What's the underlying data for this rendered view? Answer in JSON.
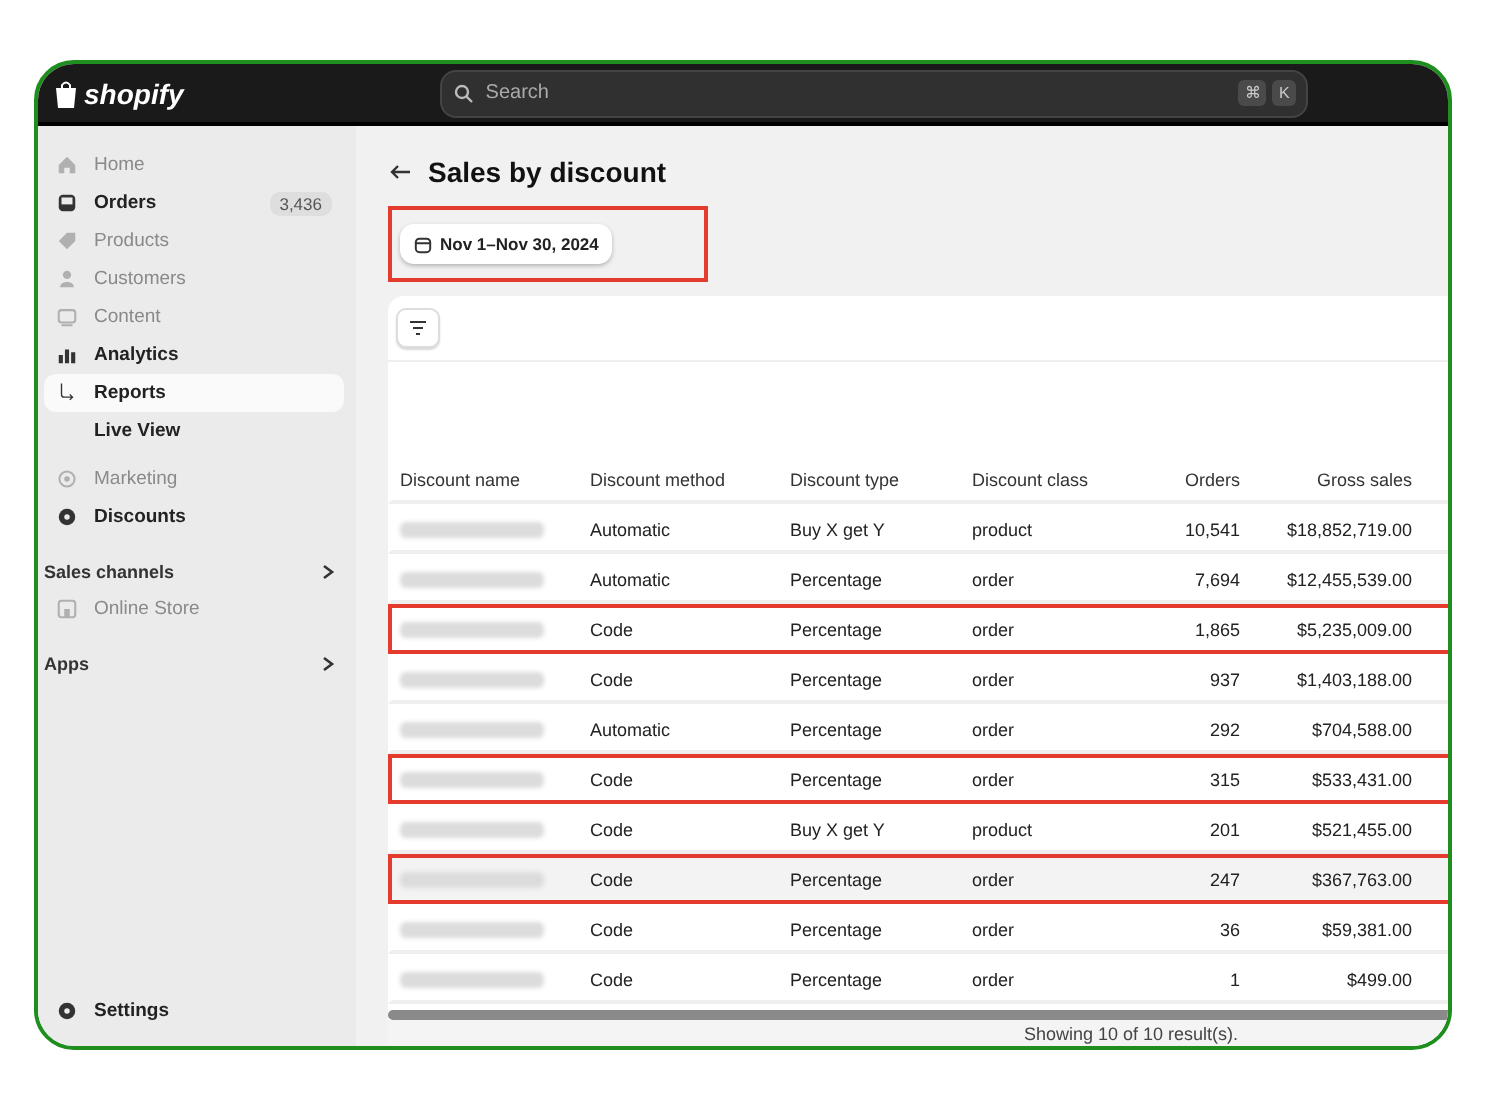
{
  "top_bar": {
    "logo": "shopify",
    "search": {
      "placeholder": "Search"
    },
    "shortcut_keys": [
      "⌘",
      "K"
    ]
  },
  "sidebar": {
    "items": [
      {
        "label": "Home",
        "dimmed": true,
        "selected": false
      },
      {
        "label": "Orders",
        "dimmed": false,
        "selected": false,
        "badge": "3,436"
      },
      {
        "label": "Products",
        "dimmed": true,
        "selected": false
      },
      {
        "label": "Customers",
        "dimmed": true,
        "selected": false
      },
      {
        "label": "Content",
        "dimmed": true,
        "selected": false
      },
      {
        "label": "Analytics",
        "dimmed": false,
        "selected": false
      },
      {
        "label": "Reports",
        "dimmed": false,
        "selected": true
      },
      {
        "label": "Live View",
        "dimmed": false,
        "selected": false
      },
      {
        "label": "Marketing",
        "dimmed": true,
        "selected": false
      },
      {
        "label": "Discounts",
        "dimmed": false,
        "selected": false
      }
    ],
    "sections": [
      {
        "label": "Sales channels",
        "items": [
          {
            "label": "Online Store",
            "dimmed": true
          }
        ]
      },
      {
        "label": "Apps"
      }
    ],
    "settings": "Settings"
  },
  "page": {
    "title": "Sales by discount",
    "date_range": {
      "label": "Nov 1–Nov 30, 2024",
      "highlighted": true
    },
    "table": {
      "columns": [
        "Discount name",
        "Discount method",
        "Discount type",
        "Discount class",
        "Orders",
        "Gross sales"
      ],
      "rows": [
        {
          "method": "Automatic",
          "type": "Buy X get Y",
          "class": "product",
          "orders": "10,541",
          "gross": "$18,852,719.00",
          "highlighted": false,
          "shaded": false
        },
        {
          "method": "Automatic",
          "type": "Percentage",
          "class": "order",
          "orders": "7,694",
          "gross": "$12,455,539.00",
          "highlighted": false,
          "shaded": false
        },
        {
          "method": "Code",
          "type": "Percentage",
          "class": "order",
          "orders": "1,865",
          "gross": "$5,235,009.00",
          "highlighted": true,
          "shaded": false
        },
        {
          "method": "Code",
          "type": "Percentage",
          "class": "order",
          "orders": "937",
          "gross": "$1,403,188.00",
          "highlighted": false,
          "shaded": false
        },
        {
          "method": "Automatic",
          "type": "Percentage",
          "class": "order",
          "orders": "292",
          "gross": "$704,588.00",
          "highlighted": false,
          "shaded": false
        },
        {
          "method": "Code",
          "type": "Percentage",
          "class": "order",
          "orders": "315",
          "gross": "$533,431.00",
          "highlighted": true,
          "shaded": false
        },
        {
          "method": "Code",
          "type": "Buy X get Y",
          "class": "product",
          "orders": "201",
          "gross": "$521,455.00",
          "highlighted": false,
          "shaded": false
        },
        {
          "method": "Code",
          "type": "Percentage",
          "class": "order",
          "orders": "247",
          "gross": "$367,763.00",
          "highlighted": true,
          "shaded": true
        },
        {
          "method": "Code",
          "type": "Percentage",
          "class": "order",
          "orders": "36",
          "gross": "$59,381.00",
          "highlighted": false,
          "shaded": false
        },
        {
          "method": "Code",
          "type": "Percentage",
          "class": "order",
          "orders": "1",
          "gross": "$499.00",
          "highlighted": false,
          "shaded": false
        }
      ],
      "footer": "Showing 10 of 10 result(s)."
    }
  }
}
